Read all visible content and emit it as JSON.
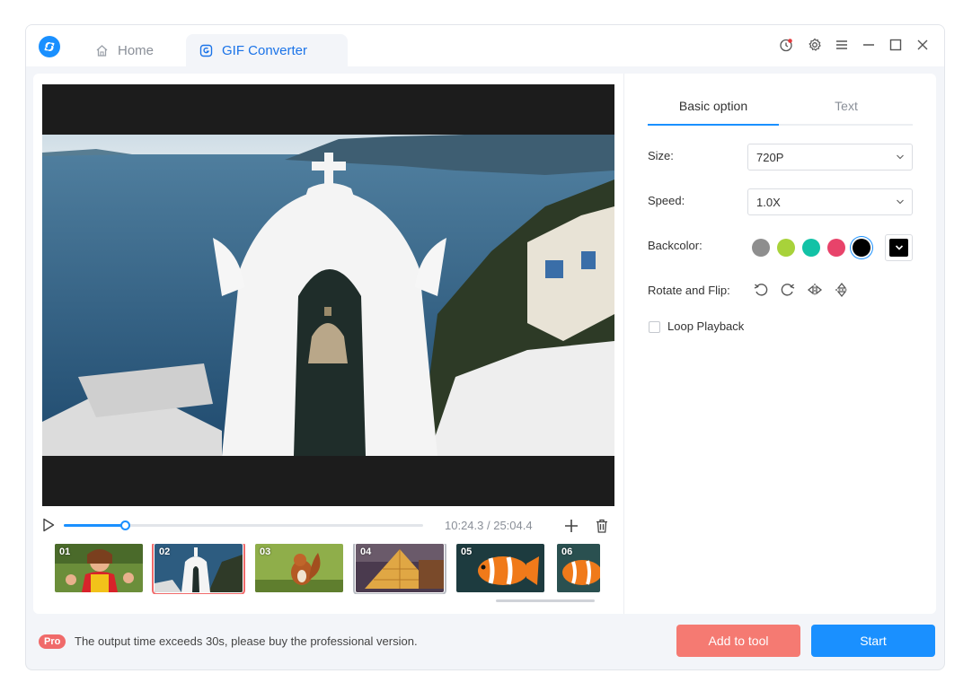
{
  "titlebar": {
    "tabs": [
      {
        "label": "Home",
        "icon": "home-icon"
      },
      {
        "label": "GIF Converter",
        "icon": "gif-converter-icon"
      }
    ],
    "controls": [
      "history-icon",
      "gear-icon",
      "menu-icon",
      "minimize-icon",
      "maximize-icon",
      "close-icon"
    ]
  },
  "player": {
    "timecode": "10:24.3 / 25:04.4",
    "progress": 0.17
  },
  "thumbnails": [
    {
      "num": "01",
      "state": "normal"
    },
    {
      "num": "02",
      "state": "selected-red"
    },
    {
      "num": "03",
      "state": "normal"
    },
    {
      "num": "04",
      "state": "selected-gray"
    },
    {
      "num": "05",
      "state": "normal"
    },
    {
      "num": "06",
      "state": "normal"
    }
  ],
  "options": {
    "tabs": {
      "basic": "Basic option",
      "text": "Text"
    },
    "size": {
      "label": "Size:",
      "value": "720P"
    },
    "speed": {
      "label": "Speed:",
      "value": "1.0X"
    },
    "backcolor": {
      "label": "Backcolor:",
      "swatches": [
        "#8e8e8e",
        "#a8d23a",
        "#12c2a6",
        "#e8436a",
        "#000000"
      ],
      "selected": "#000000"
    },
    "rotate": {
      "label": "Rotate and Flip:"
    },
    "loop": {
      "label": "Loop Playback",
      "checked": false
    }
  },
  "footer": {
    "badge": "Pro",
    "message": "The output time exceeds 30s, please buy the professional version.",
    "add_label": "Add to tool",
    "start_label": "Start"
  },
  "colors": {
    "accent": "#1a90ff",
    "danger": "#f57a72"
  }
}
